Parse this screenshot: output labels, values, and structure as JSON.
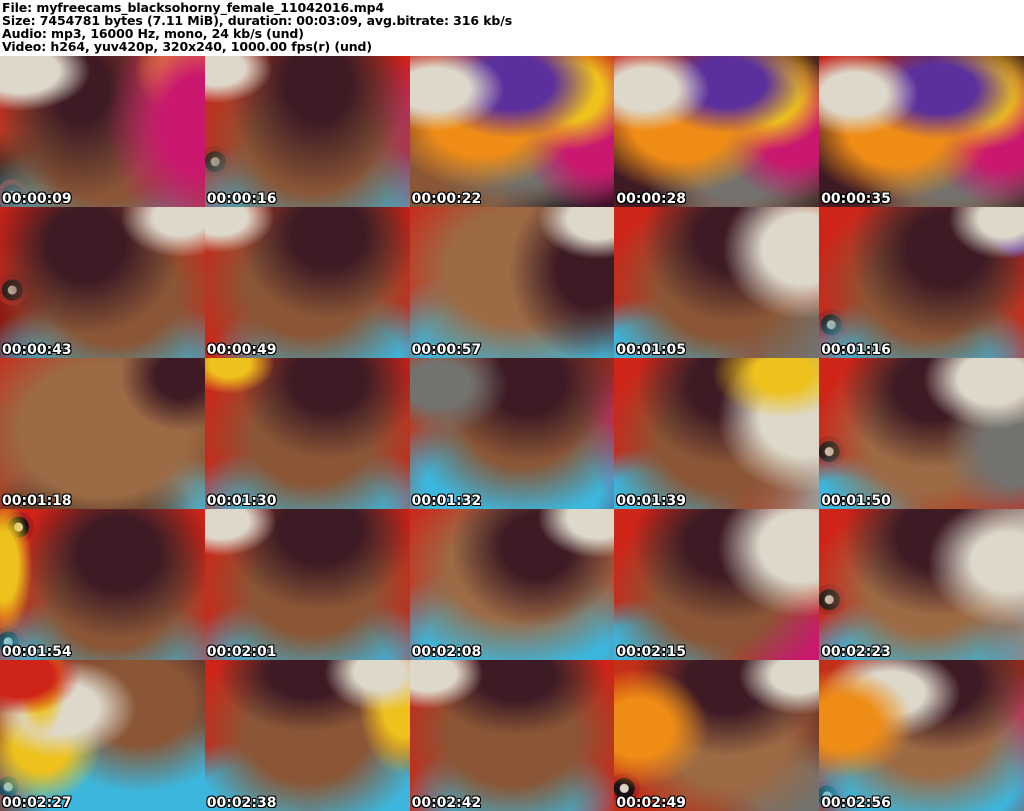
{
  "header": {
    "lines": {
      "file": "File: myfreecams_blacksohorny_female_11042016.mp4",
      "size": "Size: 7454781 bytes (7.11 MiB), duration: 00:03:09, avg.bitrate: 316 kb/s",
      "audio": "Audio: mp3, 16000 Hz, mono, 24 kb/s (und)",
      "video": "Video: h264, yuv420p, 320x240, 1000.00 fps(r) (und)"
    }
  },
  "grid": {
    "columns": 5,
    "rows": 5,
    "frame_count": 25
  },
  "palette": {
    "red_background": "#cf2418",
    "dark_red": "#8f130e",
    "cyan_garment": "#3cb6dc",
    "skin_light": "#9c6a45",
    "skin_mid": "#8a5636",
    "hair_dark": "#3d1a24",
    "pillow_white": "#ddd8ca",
    "pillow_orange": "#ef8c15",
    "pillow_yellow": "#eec11c",
    "pillow_magenta": "#c9186e",
    "pillow_purple": "#5b2f9c",
    "pillow_gray": "#73726e",
    "bedspread_dark": "#171114",
    "timestamp_text": "#ffffff",
    "header_text": "#000000"
  },
  "frames": [
    {
      "timestamp": "00:00:09",
      "style": "background:radial-gradient(70px 40px at 10% 10%, #ddd8ca 55%, #ddd8ca00),radial-gradient(95px 120px at 98% 45%, #c9186e 40%, #c9186e00),radial-gradient(50px 45px at 90% 10%, #eec11c 45%, #eec11c00),radial-gradient(85px 110px at 40% 22%, #3d1a24 30%, #3d1a2400),radial-gradient(135px 115px at 52% 62%, #8a5636 45%, #8a563600),radial-gradient(125px 65px at 46% 98%, #3cb6dc 50%, #3cb6dc00),radial-gradient(24px 24px at 6% 92%, #ddd8ca 0 4px, #171114 5px 10px, #b01c1c 11px 15px, #17111400 16px),radial-gradient(90px 70px at 8% 96%, #171114 45%, #17111400),linear-gradient(100deg, #cf2418 30%, #b03a20 55%, #cf2418 100%)"
    },
    {
      "timestamp": "00:00:16",
      "style": "background:radial-gradient(55px 35px at 6% 8%, #ddd8ca 50%, #ddd8ca00),radial-gradient(90px 110px at 55% 18%, #3d1a24 35%, #3d1a2400),radial-gradient(130px 110px at 52% 58%, #8a5636 45%, #8a563600),radial-gradient(140px 70px at 52% 97%, #3cb6dc 55%, #3cb6dc00),radial-gradient(24px 24px at 5% 70%, #ddd8ca 0 4px, #171114 5px 10px, #b01c1c 11px 15px, #17111400 16px),radial-gradient(70px 90px at 97% 60%, #c9186e 35%, #c9186e00),linear-gradient(95deg, #cf2418 22%, #a8321e 50%, #cf2418 85%)"
    },
    {
      "timestamp": "00:00:22",
      "style": "background:radial-gradient(70px 42px at 12% 22%, #ddd8ca 50%, #ddd8ca00),radial-gradient(85px 55px at 50% 18%, #5b2f9c 48%, #5b2f9c00),radial-gradient(95px 70px at 35% 42%, #ef8c15 52%, #ef8c1500),radial-gradient(68px 58px at 78% 24%, #eec11c 50%, #eec11c00),radial-gradient(78px 80px at 92% 52%, #c9186e 48%, #c9186e00),radial-gradient(105px 72px at 60% 62%, #73726e 45%, #73726e00),radial-gradient(100px 80px at 22% 82%, #8a5636 50%, #8a563600),radial-gradient(42px 24px at 20% 64%, #3cb6dc 55%, #3cb6dc00),radial-gradient(60px 45px at 92% 94%, #171114 50%, #17111400),linear-gradient(180deg, #c32014 14%, #6e241a 48%, #2a1518 100%)"
    },
    {
      "timestamp": "00:00:28",
      "style": "background:radial-gradient(65px 42px at 15% 22%, #ddd8ca 50%, #ddd8ca00),radial-gradient(80px 50px at 55% 18%, #5b2f9c 48%, #5b2f9c00),radial-gradient(95px 70px at 33% 45%, #ef8c15 52%, #ef8c1500),radial-gradient(65px 55px at 74% 26%, #eec11c 50%, #eec11c00),radial-gradient(75px 70px at 88% 50%, #c9186e 48%, #c9186e00),radial-gradient(100px 75px at 62% 72%, #73726e 45%, #73726e00),radial-gradient(80px 70px at 12% 78%, #3d1a24 45%, #3d1a2400),radial-gradient(90px 60px at 45% 85%, #8a5636 45%, #8a563600),radial-gradient(40px 22px at 30% 66%, #3cb6dc 55%, #3cb6dc00),linear-gradient(100deg, #c32014 14%, #8f2a1a 40%, #3a2420 100%)"
    },
    {
      "timestamp": "00:00:35",
      "style": "background:radial-gradient(65px 42px at 17% 25%, #ddd8ca 50%, #ddd8ca00),radial-gradient(80px 50px at 58% 22%, #5b2f9c 48%, #5b2f9c00),radial-gradient(95px 72px at 38% 48%, #ef8c15 52%, #ef8c1500),radial-gradient(65px 55px at 78% 26%, #eec11c 50%, #eec11c00),radial-gradient(78px 72px at 90% 52%, #c9186e 48%, #c9186e00),radial-gradient(100px 78px at 66% 70%, #73726e 45%, #73726e00),radial-gradient(85px 75px at 10% 75%, #3d1a24 45%, #3d1a2400),radial-gradient(95px 60px at 48% 88%, #8a5636 45%, #8a563600),radial-gradient(40px 22px at 28% 70%, #3cb6dc 55%, #3cb6dc00),linear-gradient(100deg, #c32014 14%, #8f2a1a 42%, #3a2420 100%)"
    },
    {
      "timestamp": "00:00:43",
      "style": "background:radial-gradient(60px 40px at 88% 7%, #ddd8ca 45%, #ddd8ca00),radial-gradient(95px 90px at 42% 25%, #3d1a24 40%, #3d1a2400),radial-gradient(125px 105px at 56% 58%, #8a5636 48%, #8a563600),radial-gradient(135px 60px at 55% 98%, #3cb6dc 55%, #3cb6dc00),radial-gradient(24px 24px at 6% 55%, #ddd8ca 0 4px, #171114 5px 10px, #b01c1c 11px 15px, #17111400 16px),radial-gradient(70px 60px at 5% 80%, #8f130e 50%, #8f130e00),linear-gradient(95deg, #cf2418 25%, #b03a20 55%, #cf2418 90%)"
    },
    {
      "timestamp": "00:00:49",
      "style": "background:radial-gradient(55px 35px at 7% 7%, #ddd8ca 50%, #ddd8ca00),radial-gradient(90px 85px at 60% 18%, #3d1a24 40%, #3d1a2400),radial-gradient(125px 105px at 50% 52%, #8a5636 48%, #8a563600),radial-gradient(30px 18px at 47% 52%, #c9186e 50%, #c9186e00),radial-gradient(120px 60px at 62% 96%, #3cb6dc 55%, #3cb6dc00),linear-gradient(95deg, #cf2418 25%, #b03a20 60%, #cf2418 95%)"
    },
    {
      "timestamp": "00:00:57",
      "style": "background:radial-gradient(60px 40px at 92% 8%, #ddd8ca 50%, #ddd8ca00),radial-gradient(80px 90px at 88% 42%, #3d1a24 40%, #3d1a2400),radial-gradient(140px 110px at 52% 42%, #9c6a45 50%, #9c6a4500),radial-gradient(150px 80px at 50% 92%, #3cb6dc 60%, #3cb6dc00),radial-gradient(40px 100px at 2% 50%, #cf2418 55%, #cf241800),linear-gradient(100deg, #cf2418 15%, #9c5a36 50%, #b0452a 100%)"
    },
    {
      "timestamp": "00:01:05",
      "style": "background:radial-gradient(80px 70px at 92% 28%, #ddd8ca 50%, #ddd8ca00),radial-gradient(90px 85px at 58% 20%, #3d1a24 40%, #3d1a2400),radial-gradient(120px 100px at 52% 55%, #8a5636 48%, #8a563600),radial-gradient(100px 55px at 22% 96%, #3cb6dc 55%, #3cb6dc00),radial-gradient(80px 60px at 90% 88%, #73726e 45%, #73726e00),linear-gradient(95deg, #cf2418 28%, #b03a20 55%, #cf2418 90%)"
    },
    {
      "timestamp": "00:01:16",
      "style": "background:radial-gradient(55px 40px at 90% 8%, #ddd8ca 45%, #ddd8ca00),radial-gradient(26px 22px at 96% 20%, #5b2f9c 50%, #5b2f9c00),radial-gradient(95px 90px at 62% 28%, #3d1a24 40%, #3d1a2400),radial-gradient(115px 100px at 52% 55%, #8a5636 48%, #8a563600),radial-gradient(125px 60px at 48% 97%, #3cb6dc 55%, #3cb6dc00),radial-gradient(24px 24px at 6% 78%, #ddd8ca 0 4px, #171114 5px 10px, #b01c1c 11px 15px, #17111400 16px),linear-gradient(95deg, #cf2418 25%, #b03a20 55%, #cf2418 92%)"
    },
    {
      "timestamp": "00:01:18",
      "style": "background:radial-gradient(60px 55px at 88% 12%, #3d1a24 40%, #3d1a2400),radial-gradient(150px 120px at 50% 48%, #9c6a45 55%, #9c6a4500),radial-gradient(60px 45px at 10% 15%, #cf2418 55%, #cf241800),radial-gradient(100px 50px at 45% 98%, #171114 50%, #17111400),radial-gradient(70px 45px at 85% 94%, #3cb6dc 50%, #3cb6dc00),linear-gradient(110deg, #b03020 20%, #8a5636 55%, #6e4226 100%)"
    },
    {
      "timestamp": "00:01:30",
      "style": "background:radial-gradient(45px 30px at 12% 4%, #eec11c 45%, #eec11c00),radial-gradient(90px 80px at 60% 14%, #3d1a24 40%, #3d1a2400),radial-gradient(120px 100px at 52% 52%, #8a5636 48%, #8a563600),radial-gradient(26px 14px at 46% 56%, #f0ece2 55%, #f0ece200),radial-gradient(130px 62px at 52% 96%, #3cb6dc 55%, #3cb6dc00),linear-gradient(95deg, #cf2418 25%, #b03a20 55%, #cf2418 90%)"
    },
    {
      "timestamp": "00:01:32",
      "style": "background:radial-gradient(70px 50px at 14% 18%, #73726e 45%, #73726e00),radial-gradient(90px 80px at 58% 16%, #3d1a24 40%, #3d1a2400),radial-gradient(115px 95px at 55% 42%, #8a5636 48%, #8a563600),radial-gradient(150px 90px at 50% 88%, #3cb6dc 58%, #3cb6dc00),radial-gradient(70px 80px at 94% 58%, #c9186e 45%, #c9186e00),radial-gradient(60px 45px at 90% 96%, #171114 45%, #17111400),linear-gradient(100deg, #c33018 20%, #a8321e 45%, #8f2a20 100%)"
    },
    {
      "timestamp": "00:01:39",
      "style": "background:radial-gradient(70px 45px at 82% 10%, #eec11c 40%, #eec11c00),radial-gradient(85px 75px at 92% 40%, #ddd8ca 50%, #ddd8ca00),radial-gradient(90px 80px at 55% 18%, #3d1a24 40%, #3d1a2400),radial-gradient(115px 100px at 50% 55%, #8a5636 48%, #8a563600),radial-gradient(95px 55px at 18% 96%, #3cb6dc 55%, #3cb6dc00),linear-gradient(95deg, #cf2418 28%, #b03a20 60%, #9c9a96 100%)"
    },
    {
      "timestamp": "00:01:50",
      "style": "background:radial-gradient(70px 50px at 85% 14%, #ddd8ca 50%, #ddd8ca00),radial-gradient(70px 80px at 95% 60%, #73726e 45%, #73726e00),radial-gradient(90px 80px at 55% 20%, #3d1a24 40%, #3d1a2400),radial-gradient(115px 100px at 52% 55%, #9c6a45 48%, #9c6a4500),radial-gradient(26px 16px at 50% 58%, #f0ece2 55%, #f0ece200),radial-gradient(85px 50px at 12% 97%, #3cb6dc 50%, #3cb6dc00),radial-gradient(24px 24px at 5% 62%, #ddd8ca 0 4px, #171114 5px 10px, #b01c1c 11px 15px, #17111400 16px),linear-gradient(95deg, #cf2418 25%, #b03a20 55%, #cf2418 90%)"
    },
    {
      "timestamp": "00:01:54",
      "style": "background:radial-gradient(28px 70px at 2% 38%, #eec11c 50%, #eec11c00),radial-gradient(24px 24px at 9% 12%, #ddd8ca 0 4px, #171114 5px 10px, #b01c1c 11px 15px, #17111400 16px),radial-gradient(95px 85px at 58% 30%, #3d1a24 42%, #3d1a2400),radial-gradient(115px 95px at 55% 62%, #8a5636 48%, #8a563600),radial-gradient(130px 60px at 50% 97%, #3cb6dc 55%, #3cb6dc00),radial-gradient(24px 24px at 4% 88%, #ddd8ca 0 4px, #171114 5px 10px, #b01c1c 11px 15px, #17111400 16px),linear-gradient(95deg, #cf2418 28%, #b03a20 58%, #cf2418 92%)"
    },
    {
      "timestamp": "00:02:01",
      "style": "background:radial-gradient(55px 35px at 8% 8%, #ddd8ca 50%, #ddd8ca00),radial-gradient(95px 80px at 56% 14%, #3d1a24 42%, #3d1a2400),radial-gradient(120px 100px at 52% 52%, #8a5636 48%, #8a563600),radial-gradient(130px 62px at 52% 96%, #3cb6dc 55%, #3cb6dc00),linear-gradient(95deg, #cf2418 25%, #b03a20 55%, #cf2418 90%)"
    },
    {
      "timestamp": "00:02:08",
      "style": "background:radial-gradient(60px 40px at 92% 6%, #ddd8ca 50%, #ddd8ca00),radial-gradient(85px 80px at 62% 25%, #3d1a24 40%, #3d1a2400),radial-gradient(135px 100px at 52% 40%, #9c6a45 50%, #9c6a4500),radial-gradient(150px 85px at 52% 90%, #3cb6dc 60%, #3cb6dc00),radial-gradient(35px 100px at 2% 45%, #cf2418 55%, #cf241800),linear-gradient(100deg, #cf2418 15%, #a8543a 50%, #b0452a 100%)"
    },
    {
      "timestamp": "00:02:15",
      "style": "background:radial-gradient(85px 70px at 92% 25%, #ddd8ca 50%, #ddd8ca00),radial-gradient(95px 80px at 55% 22%, #3d1a24 42%, #3d1a2400),radial-gradient(115px 95px at 50% 58%, #8a5636 48%, #8a563600),radial-gradient(95px 55px at 15% 96%, #3cb6dc 55%, #3cb6dc00),radial-gradient(70px 55px at 92% 92%, #c9186e 45%, #c9186e00),linear-gradient(95deg, #cf2418 28%, #b03a20 58%, #cf2418 92%)"
    },
    {
      "timestamp": "00:02:23",
      "style": "background:radial-gradient(80px 65px at 92% 35%, #ddd8ca 45%, #ddd8ca00),radial-gradient(95px 80px at 58% 18%, #3d1a24 42%, #3d1a2400),radial-gradient(115px 95px at 52% 52%, #9c6a45 48%, #9c6a4500),radial-gradient(120px 58px at 45% 96%, #3cb6dc 55%, #3cb6dc00),radial-gradient(24px 24px at 5% 60%, #ddd8ca 0 4px, #171114 5px 10px, #b01c1c 11px 15px, #17111400 16px),linear-gradient(95deg, #cf2418 25%, #b03a20 55%, #8a8884 100%)"
    },
    {
      "timestamp": "00:02:27",
      "style": "background:radial-gradient(60px 40px at 10% 10%, #cf2418 55%, #cf241800),radial-gradient(26px 60px at 20% 12%, #eec11c 50%, #eec11c00),radial-gradient(75px 50px at 30% 32%, #ddd8ca 50%, #ddd8ca00),radial-gradient(60px 55px at 20% 58%, #eec11c 45%, #eec11c00),radial-gradient(110px 90px at 68% 28%, #8a5636 48%, #8a563600),radial-gradient(70px 60px at 90% 10%, #3d1a24 42%, #3d1a2400),radial-gradient(150px 95px at 62% 82%, #3cb6dc 58%, #3cb6dc00),radial-gradient(24px 24px at 4% 84%, #ddd8ca 0 4px, #171114 5px 10px, #b01c1c 11px 15px, #17111400 16px),linear-gradient(110deg, #8f2a1a 20%, #6e3a24 55%, #3a2420 100%)"
    },
    {
      "timestamp": "00:02:38",
      "style": "background:radial-gradient(55px 40px at 85% 8%, #ddd8ca 45%, #ddd8ca00),radial-gradient(45px 70px at 97% 30%, #eec11c 45%, #eec11c00),radial-gradient(90px 60px at 50% 8%, #3d1a24 42%, #3d1a2400),radial-gradient(120px 100px at 50% 48%, #8a5636 50%, #8a563600),radial-gradient(90px 60px at 22% 92%, #3cb6dc 55%, #3cb6dc00),radial-gradient(90px 60px at 78% 88%, #3cb6dc 55%, #3cb6dc00),radial-gradient(50px 45px at 95% 95%, #171114 45%, #17111400),linear-gradient(95deg, #cf2418 22%, #b03a20 55%, #a8321e 95%)"
    },
    {
      "timestamp": "00:02:42",
      "style": "background:radial-gradient(55px 35px at 9% 9%, #ddd8ca 50%, #ddd8ca00),radial-gradient(90px 60px at 52% 10%, #3d1a24 42%, #3d1a2400),radial-gradient(125px 100px at 50% 50%, #8a5636 50%, #8a563600),radial-gradient(110px 60px at 50% 92%, #3cb6dc 55%, #3cb6dc00),radial-gradient(45px 90px at 98% 55%, #cf2418 55%, #cf241800),linear-gradient(95deg, #cf2418 22%, #b03a20 52%, #cf2418 88%)"
    },
    {
      "timestamp": "00:02:49",
      "style": "background:radial-gradient(70px 60px at 12% 45%, #ef8c15 48%, #ef8c1500),radial-gradient(60px 40px at 90% 10%, #ddd8ca 45%, #ddd8ca00),radial-gradient(95px 75px at 55% 14%, #3d1a24 42%, #3d1a2400),radial-gradient(115px 95px at 55% 52%, #9c6a45 50%, #9c6a4500),radial-gradient(80px 60px at 88% 90%, #73726e 45%, #73726e00),radial-gradient(24px 24px at 5% 85%, #ddd8ca 0 4px, #171114 5px 10px, #b01c1c 11px 15px, #17111400 16px),linear-gradient(100deg, #c33018 25%, #a8321e 55%, #57201a 100%)"
    },
    {
      "timestamp": "00:02:56",
      "style": "background:radial-gradient(70px 55px at 12% 42%, #ef8c15 48%, #ef8c1500),radial-gradient(70px 45px at 35% 22%, #ddd8ca 48%, #ddd8ca00),radial-gradient(90px 70px at 60% 15%, #3d1a24 42%, #3d1a2400),radial-gradient(120px 95px at 55% 45%, #9c6a45 50%, #9c6a4500),radial-gradient(140px 85px at 55% 82%, #3cb6dc 58%, #3cb6dc00),radial-gradient(55px 70px at 96% 55%, #c9186e 45%, #c9186e00),radial-gradient(24px 24px at 4% 90%, #ddd8ca 0 4px, #171114 5px 10px, #b01c1c 11px 15px, #17111400 16px),linear-gradient(100deg, #c33018 22%, #a8321e 55%, #8f2a1a 100%)"
    }
  ]
}
